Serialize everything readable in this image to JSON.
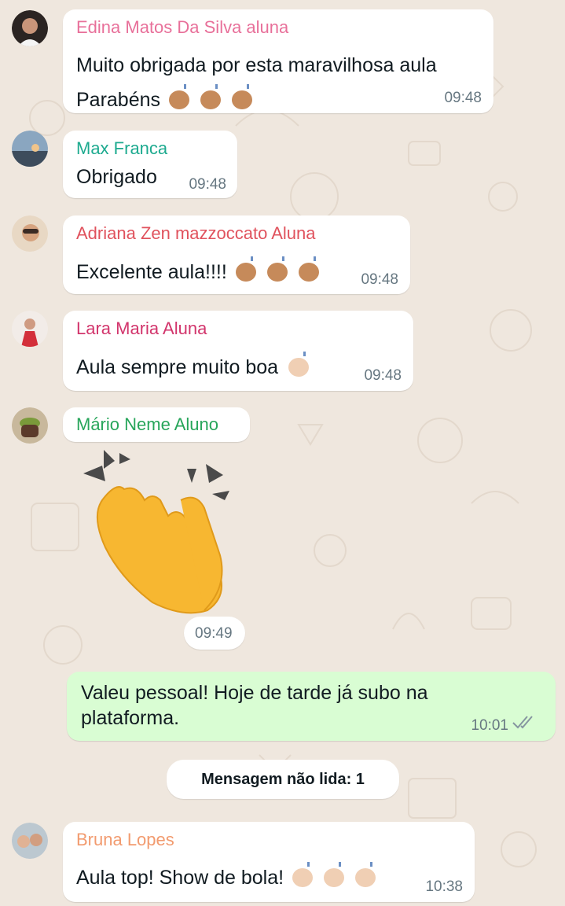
{
  "colors": {
    "wallpaper": "#efe7de",
    "incoming_bubble": "#ffffff",
    "outgoing_bubble": "#d9fdd3",
    "timestamp": "#667781",
    "read_ticks": "#8696a0"
  },
  "messages": [
    {
      "sender": "Edina Matos Da Silva aluna",
      "sender_color": "#e8709a",
      "lines": [
        "Muito obrigada por esta maravilhosa aula",
        "Parabéns"
      ],
      "emoji": "three-clapping-hands-medium-skin",
      "time": "09:48"
    },
    {
      "sender": "Max Franca",
      "sender_color": "#1daa8f",
      "lines": [
        "Obrigado"
      ],
      "time": "09:48"
    },
    {
      "sender": "Adriana Zen mazzoccato Aluna",
      "sender_color": "#e0525d",
      "lines": [
        "Excelente aula!!!!"
      ],
      "emoji": "three-clapping-hands-medium-skin",
      "time": "09:48"
    },
    {
      "sender": "Lara Maria Aluna",
      "sender_color": "#d2356c",
      "lines": [
        "Aula sempre muito boa"
      ],
      "emoji": "clapping-hands-light-skin",
      "time": "09:48"
    },
    {
      "sender": "Mário Neme Aluno",
      "sender_color": "#27a55a",
      "sticker": "clapping-hands-sticker",
      "time": "09:49"
    },
    {
      "sender": "",
      "outgoing": true,
      "lines": [
        "Valeu pessoal! Hoje de tarde já subo na",
        "plataforma."
      ],
      "time": "10:01",
      "status": "read"
    },
    {
      "sender": "Bruna Lopes",
      "sender_color": "#f29b6f",
      "lines": [
        "Aula top! Show de bola!"
      ],
      "emoji": "three-clapping-hands-light-skin",
      "time": "10:38"
    }
  ],
  "unread_banner": "Mensagem não lida: 1"
}
